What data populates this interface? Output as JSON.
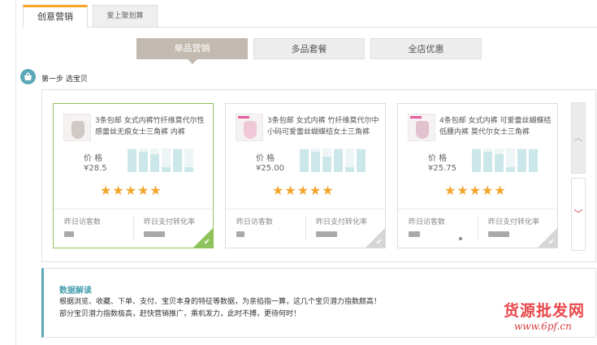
{
  "tabs": {
    "active": "创意营销",
    "inactive": "爱上聚划算"
  },
  "modes": [
    "单品营销",
    "多品套餐",
    "全店优惠"
  ],
  "step": {
    "label": "第一步  选宝贝"
  },
  "products": [
    {
      "title": "3条包邮 女式内裤竹纤维莫代尔性感蕾丝无痕女士三角裤 内裤",
      "price_label": "价 格",
      "price": "¥28.5",
      "rating": 5,
      "bars": [
        0.95,
        0.85,
        0.75,
        0.2,
        0.95,
        0.2
      ],
      "visitors_label": "昨日访客数",
      "conversion_label": "昨日支付转化率",
      "visitors_value": "",
      "conversion_value": "",
      "selected": true
    },
    {
      "title": "3条包邮 女式内裤 竹纤维莫代尔中小码可爱蕾丝蝴蝶结女士三角裤",
      "price_label": "价 格",
      "price": "¥25.00",
      "rating": 5,
      "bars": [
        0.95,
        0.85,
        0.65,
        0.95,
        0.2,
        0.95
      ],
      "visitors_label": "昨日访客数",
      "conversion_label": "昨日支付转化率",
      "visitors_value": "",
      "conversion_value": "",
      "selected": false
    },
    {
      "title": "4条包邮 女式内裤 可爱蕾丝蝴蝶结低腰内裤 莫代尔女士三角裤",
      "price_label": "价 格",
      "price": "¥25.75",
      "rating": 5,
      "bars": [
        0.95,
        0.85,
        0.75,
        0.2,
        0.95,
        0.95
      ],
      "visitors_label": "昨日访客数",
      "conversion_label": "昨日支付转化率",
      "visitors_value": "",
      "conversion_value": "",
      "selected": false
    }
  ],
  "note": {
    "title": "数据解读",
    "line1": "根据浏览、收藏、下单、支付、宝贝本身的特征等数据，为亲掐指一算，这几个宝贝潜力指数颇高！",
    "line2": "部分宝贝潜力指数极高，赶快营销推广，乘机发力，此时不搏，更待何时！"
  },
  "watermark": {
    "text": "货源批发网",
    "url": "www.6pf.cn"
  },
  "colors": {
    "accent_tab": "#f5a623",
    "teal": "#5aa8b8",
    "star": "#f2a52a",
    "selected": "#8ec25a"
  }
}
